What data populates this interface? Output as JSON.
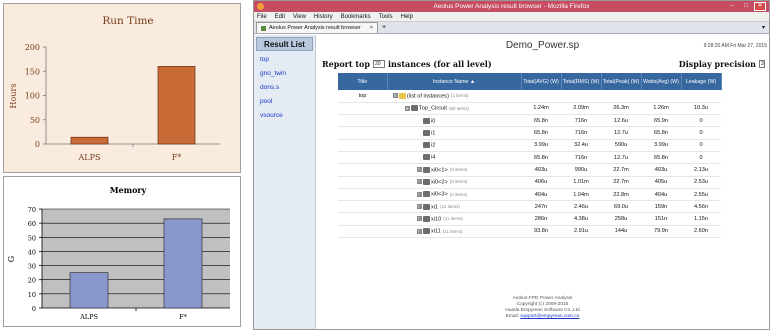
{
  "charts_left": [
    {
      "type": "bar",
      "title": "Run Time",
      "ylabel": "Hours",
      "categories": [
        "ALPS",
        "F*"
      ],
      "values": [
        14,
        160
      ],
      "ylim": [
        0,
        200
      ],
      "yticks": [
        0,
        50,
        100,
        150,
        200
      ],
      "bar_color": "#c86b36"
    },
    {
      "type": "bar",
      "title": "Memory",
      "ylabel": "G",
      "categories": [
        "ALPS",
        "F*"
      ],
      "values": [
        25,
        63
      ],
      "ylim": [
        0,
        70
      ],
      "yticks": [
        0,
        10,
        20,
        30,
        40,
        50,
        60,
        70
      ],
      "bar_color": "#8a97cc",
      "grid": true
    }
  ],
  "chart_data": [
    {
      "type": "bar",
      "title": "Run Time",
      "ylabel": "Hours",
      "categories": [
        "ALPS",
        "F*"
      ],
      "values": [
        14,
        160
      ],
      "ylim": [
        0,
        200
      ]
    },
    {
      "type": "bar",
      "title": "Memory",
      "ylabel": "G",
      "categories": [
        "ALPS",
        "F*"
      ],
      "values": [
        25,
        63
      ],
      "ylim": [
        0,
        70
      ],
      "grid": true
    }
  ],
  "browser": {
    "title": "Aeolus Power Analysis result browser - Mozilla Firefox",
    "menu": [
      "File",
      "Edit",
      "View",
      "History",
      "Bookmarks",
      "Tools",
      "Help"
    ],
    "tab_label": "Aeolus Power Analysis result browser",
    "new_tab": "+",
    "sidebar": {
      "header": "Result List",
      "items": [
        "top",
        "gno_twin",
        "dons.s",
        "pool",
        "vsource"
      ]
    },
    "design_name": "Demo_Power.sp",
    "timestamp": "9:28:20 AM Fri Mar 27, 2015",
    "report_label_a": "Report top",
    "report_count": "20",
    "report_label_b": "instances (for all level)",
    "precision_label": "Display precision",
    "precision_value": "3",
    "columns": [
      "Title",
      "Instance Name ▲",
      "Total(AVG) (W)",
      "Total(RMS) (W)",
      "Total(Peak) (W)",
      "Watts(Avg) (W)",
      "Leakage (W)"
    ],
    "rows": [
      {
        "title": "top",
        "indent": 0,
        "tw": "⊟",
        "icon": "folder",
        "name": "(list of instances)",
        "count": "(1 items)",
        "v": [
          "",
          "",
          "",
          "",
          ""
        ]
      },
      {
        "title": "",
        "indent": 1,
        "tw": "⊟",
        "icon": "mod",
        "name": "Top_Circuit",
        "count": "(60 items)",
        "v": [
          "1.24m",
          "2.09m",
          "26.3m",
          "1.26m",
          "10.3u"
        ]
      },
      {
        "title": "",
        "indent": 2,
        "tw": "",
        "icon": "mod",
        "name": "i0",
        "count": "",
        "v": [
          "65.8n",
          "716n",
          "12.6u",
          "65.9n",
          "0"
        ]
      },
      {
        "title": "",
        "indent": 2,
        "tw": "",
        "icon": "mod",
        "name": "i1",
        "count": "",
        "v": [
          "65.8n",
          "716n",
          "12.7u",
          "65.8n",
          "0"
        ]
      },
      {
        "title": "",
        "indent": 2,
        "tw": "",
        "icon": "mod",
        "name": "i2",
        "count": "",
        "v": [
          "3.99u",
          "32.4u",
          "590u",
          "3.99u",
          "0"
        ]
      },
      {
        "title": "",
        "indent": 2,
        "tw": "",
        "icon": "mod",
        "name": "i4",
        "count": "",
        "v": [
          "65.8n",
          "716n",
          "12.7u",
          "65.8n",
          "0"
        ]
      },
      {
        "title": "",
        "indent": 2,
        "tw": "⊞",
        "icon": "mod",
        "name": "xi0<1>",
        "count": "(3 items)",
        "v": [
          "403u",
          "990u",
          "22.7m",
          "403u",
          "2.13u"
        ]
      },
      {
        "title": "",
        "indent": 2,
        "tw": "⊞",
        "icon": "mod",
        "name": "xi0<2>",
        "count": "(3 items)",
        "v": [
          "406u",
          "1.01m",
          "22.7m",
          "405u",
          "2.53u"
        ]
      },
      {
        "title": "",
        "indent": 2,
        "tw": "⊞",
        "icon": "mod",
        "name": "xi0<3>",
        "count": "(3 items)",
        "v": [
          "404u",
          "1.04m",
          "22.8m",
          "404u",
          "2.55u"
        ]
      },
      {
        "title": "",
        "indent": 2,
        "tw": "⊞",
        "icon": "mod",
        "name": "xi1",
        "count": "(11 items)",
        "v": [
          "247n",
          "2.46u",
          "69.0u",
          "159n",
          "4.56n"
        ]
      },
      {
        "title": "",
        "indent": 2,
        "tw": "⊞",
        "icon": "mod",
        "name": "xi10",
        "count": "(11 items)",
        "v": [
          "286n",
          "4.38u",
          "258u",
          "151n",
          "1.15n"
        ]
      },
      {
        "title": "",
        "indent": 2,
        "tw": "⊞",
        "icon": "mod",
        "name": "xi11",
        "count": "(11 items)",
        "v": [
          "93.8n",
          "2.91u",
          "144u",
          "79.9n",
          "2.60n"
        ]
      }
    ],
    "footer": {
      "line1": "Aeolus-FPD Power Analysis",
      "line2": "Copyright (c) 2009-2015",
      "line3": "Huada Empyrean Software Co.,Ltd",
      "email_label": "Email:",
      "email": "support@empyrean.com.cn"
    }
  }
}
